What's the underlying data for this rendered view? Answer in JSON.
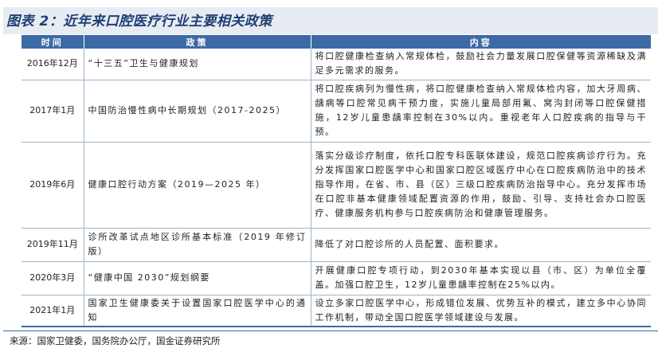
{
  "title": "图表 2：近年来口腔医疗行业主要相关政策",
  "table": {
    "headers": [
      "时间",
      "政策",
      "内容"
    ],
    "rows": [
      {
        "time": "2016年12月",
        "policy": "“十三五”卫生与健康规划",
        "content": "将口腔健康检查纳入常规体检，鼓励社会力量发展口腔保健等资源稀缺及满足多元需求的服务。"
      },
      {
        "time": "2017年1月",
        "policy": "中国防治慢性病中长期规划（2017-2025）",
        "content": "将口腔疾病列为慢性病，将口腔健康检查纳入常规体检内容，加大牙周病、龋病等口腔常见病干预力度，实施儿童局部用氟、窝沟封闭等口腔保健措施，12岁儿童患龋率控制在30%以内。重视老年人口腔疾病的指导与干预。"
      },
      {
        "time": "2019年6月",
        "policy": "健康口腔行动方案（2019—2025 年）",
        "content": "落实分级诊疗制度，依托口腔专科医联体建设，规范口腔疾病诊疗行为。充分发挥国家口腔医学中心和国家口腔区域医疗中心在口腔疾病防治中的技术指导作用，在省、市、县（区）三级口腔疾病防治指导中心。充分发挥市场在口腔非基本健康领域配置资源的作用，鼓励、引导、支持社会办口腔医疗、健康服务机构参与口腔疾病防治和健康管理服务。"
      },
      {
        "time": "2019年11月",
        "policy": "诊所改革试点地区诊所基本标准（2019 年修订版）",
        "content": "降低了对口腔诊所的人员配置、面积要求。"
      },
      {
        "time": "2020年3月",
        "policy": "“健康中国 2030”规划纲要",
        "content": "开展健康口腔专项行动，到2030年基本实现以县（市、区）为单位全覆盖。加强口腔卫生，12岁儿童患龋率控制在25%以内。"
      },
      {
        "time": "2021年1月",
        "policy": "国家卫生健康委关于设置国家口腔医学中心的通知",
        "content": "设立多家口腔医学中心，形成错位发展、优势互补的模式，建立多中心协同工作机制，带动全国口腔医学领域建设与发展。"
      }
    ]
  },
  "source": "来源：国家卫健委，国务院办公厅，国金证券研究所"
}
